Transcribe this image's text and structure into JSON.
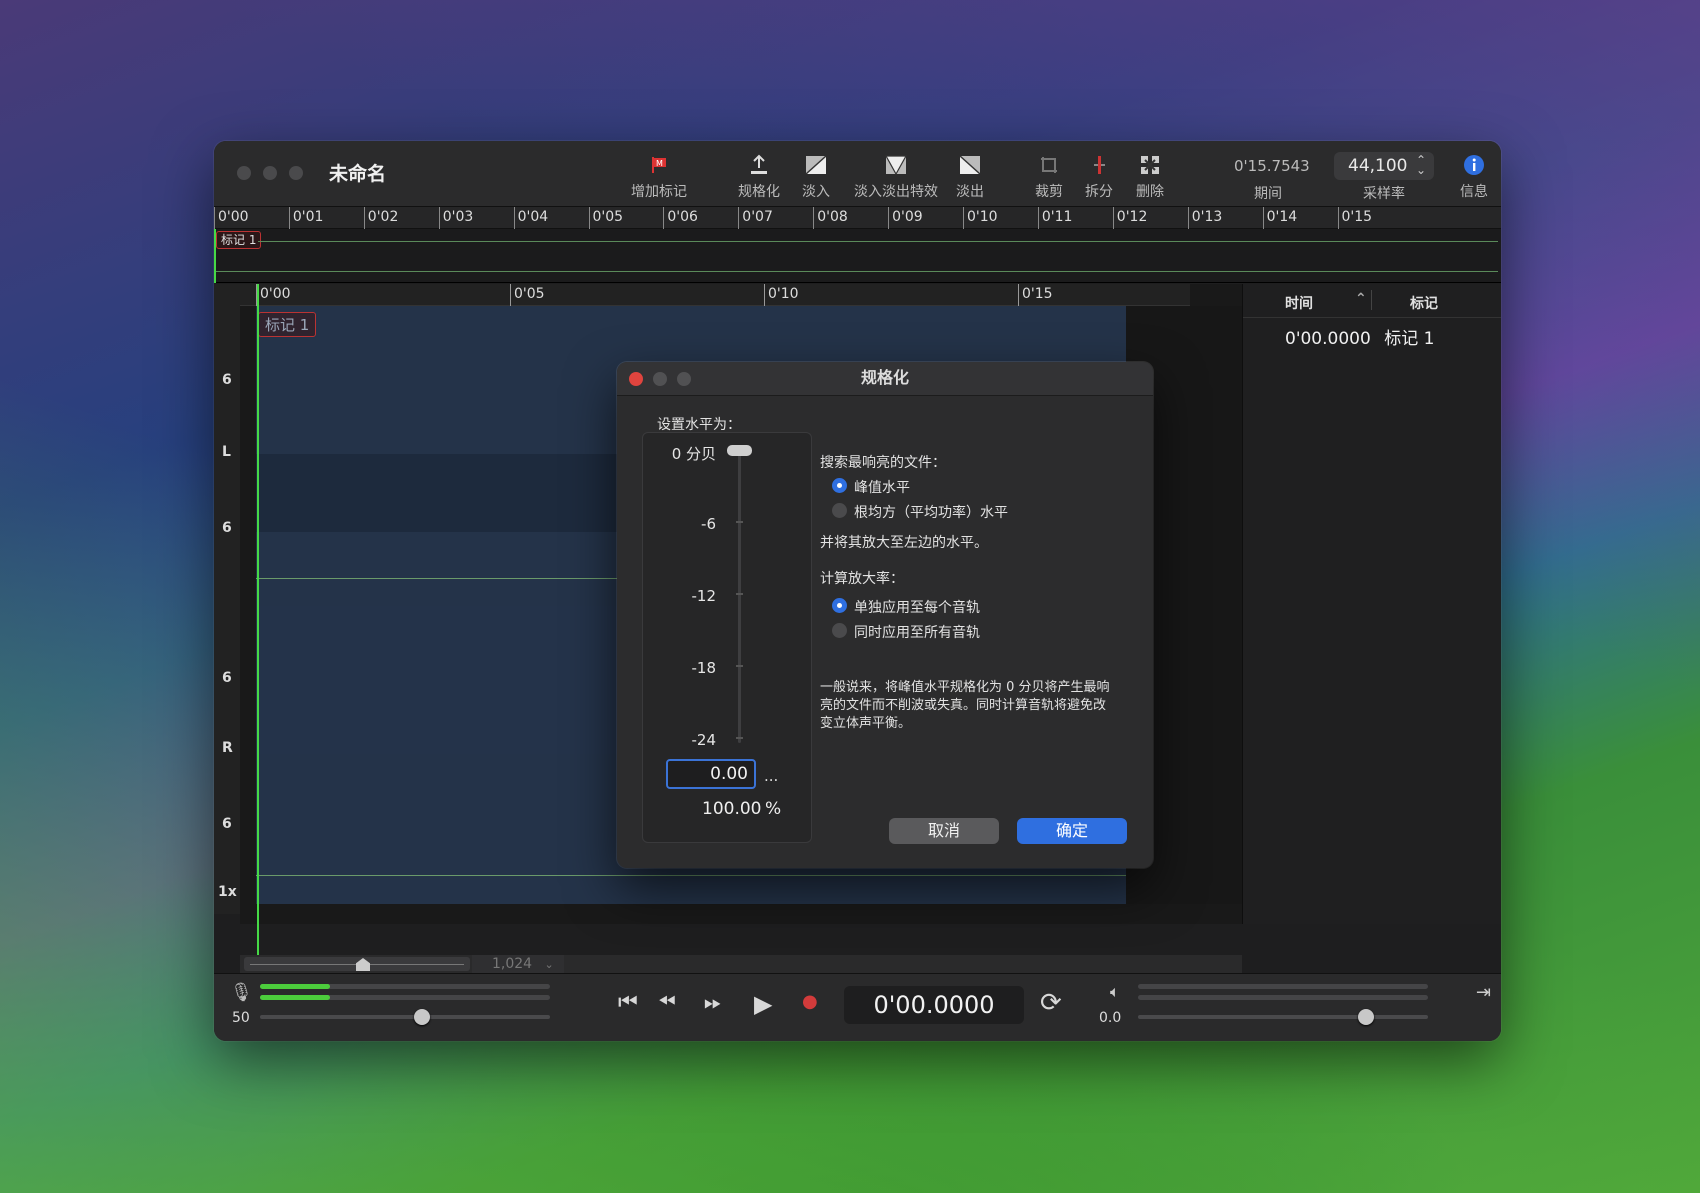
{
  "window": {
    "title": "未命名"
  },
  "toolbar": {
    "add_marker": "增加标记",
    "normalize": "规格化",
    "fade_in": "淡入",
    "fade_in_out": "淡入淡出特效",
    "fade_out": "淡出",
    "crop": "裁剪",
    "split": "拆分",
    "delete": "删除",
    "duration_value": "0'15.7543",
    "duration_label": "期间",
    "sample_rate_value": "44,100",
    "sample_rate_label": "采样率",
    "info_label": "信息"
  },
  "overview_ruler": [
    "0'00",
    "0'01",
    "0'02",
    "0'03",
    "0'04",
    "0'05",
    "0'06",
    "0'07",
    "0'08",
    "0'09",
    "0'10",
    "0'11",
    "0'12",
    "0'13",
    "0'14",
    "0'15"
  ],
  "overview_marker": "标记 1",
  "wave_ruler": [
    "0'00",
    "0'05",
    "0'10",
    "0'15"
  ],
  "wave_marker": "标记 1",
  "vscale": {
    "l_top": "6",
    "l_label": "L",
    "l_bottom": "6",
    "r_top": "6",
    "r_label": "R",
    "r_bottom": "6",
    "zoom": "1x"
  },
  "markers_panel": {
    "col_time": "时间",
    "col_marker": "标记",
    "rows": [
      {
        "time": "0'00.0000",
        "name": "标记 1"
      }
    ]
  },
  "zoom_bar": {
    "value": "1,024"
  },
  "bottom": {
    "input_gain": "50",
    "time": "0'00.0000",
    "output_gain": "0.0"
  },
  "dialog": {
    "title": "规格化",
    "set_level_label": "设置水平为：",
    "scale_labels": [
      "0 分贝",
      "-6",
      "-12",
      "-18",
      "-24"
    ],
    "db_value": "0.00",
    "db_more": "...",
    "percent_value": "100.00",
    "percent_unit": "%",
    "search_label": "搜索最响亮的文件：",
    "opt_peak": "峰值水平",
    "opt_rms": "根均方（平均功率）水平",
    "amplify_note": "并将其放大至左边的水平。",
    "calc_label": "计算放大率：",
    "opt_each": "单独应用至每个音轨",
    "opt_all": "同时应用至所有音轨",
    "help_line1": "一般说来，将峰值水平规格化为 0 分贝将产生最响",
    "help_line2": "亮的文件而不削波或失真。同时计算音轨将避免改",
    "help_line3": "变立体声平衡。",
    "cancel": "取消",
    "ok": "确定"
  },
  "colors": {
    "accent": "#2f6fe0",
    "waveform_bg": "#233148",
    "playhead": "#46d946",
    "marker_border": "#bb3333",
    "record": "#d23b3b"
  }
}
